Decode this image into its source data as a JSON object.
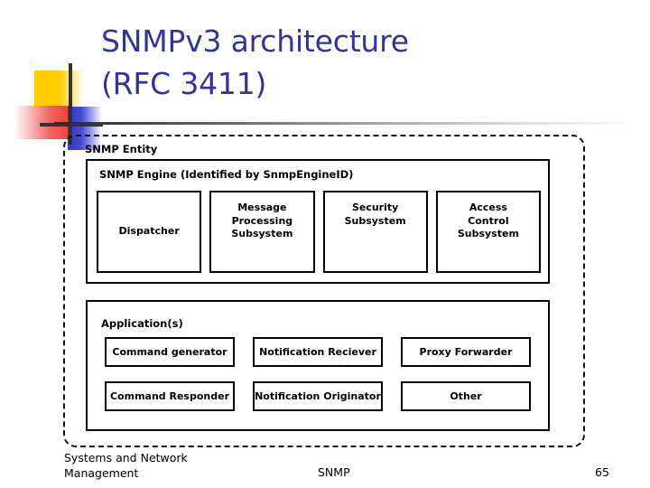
{
  "slide": {
    "title": "SNMPv3 architecture\n(RFC 3411)",
    "title_color": "#333399"
  },
  "decoration": {
    "yellow_block": "yellow-square",
    "red_block": "red-square",
    "blue_block": "blue-square",
    "vertical_line": "vertical-rule",
    "horizontal_line": "horizontal-rule",
    "colors": {
      "yellow": "#FFCC00",
      "red": "#F04040",
      "blue": "#3333CC",
      "line": "#333333"
    }
  },
  "diagram": {
    "entity_label": "SNMP Entity",
    "engine_label": "SNMP Engine (Identified by SnmpEngineID)",
    "engine_components": [
      {
        "label": "Dispatcher",
        "align": "middle"
      },
      {
        "label": "Message\nProcessing\nSubsystem",
        "align": "top"
      },
      {
        "label": "Security\nSubsystem",
        "align": "top"
      },
      {
        "label": "Access\nControl\nSubsystem",
        "align": "top"
      }
    ],
    "applications_label": "Application(s)",
    "application_rows": [
      [
        {
          "label": "Command generator"
        },
        {
          "label": "Notification Reciever"
        },
        {
          "label": "Proxy Forwarder"
        }
      ],
      [
        {
          "label": "Command Responder"
        },
        {
          "label": "Notification Originator"
        },
        {
          "label": "Other"
        }
      ]
    ]
  },
  "footer": {
    "left": "Systems and Network\nManagement",
    "center": "SNMP",
    "page_number": "65"
  }
}
